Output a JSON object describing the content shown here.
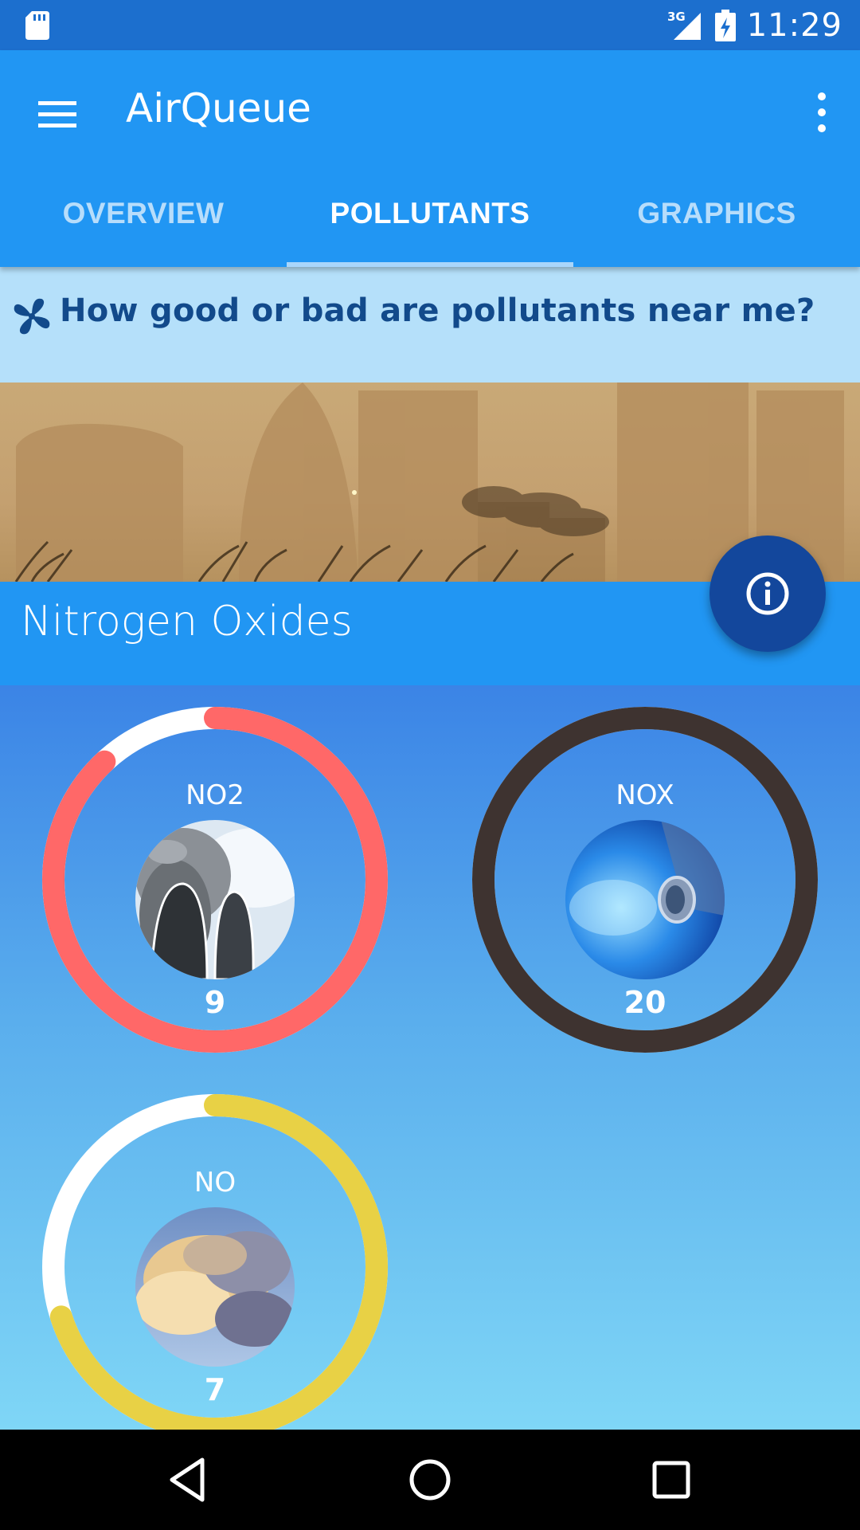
{
  "status_bar": {
    "network": "3G",
    "time": "11:29"
  },
  "app_bar": {
    "title": "AirQueue"
  },
  "tabs": [
    {
      "label": "OVERVIEW",
      "active": false
    },
    {
      "label": "POLLUTANTS",
      "active": true
    },
    {
      "label": "GRAPHICS",
      "active": false
    }
  ],
  "question": {
    "text": "How good or bad are pollutants near me?"
  },
  "section": {
    "title": "Nitrogen Oxides"
  },
  "pollutants": [
    {
      "name": "NO2",
      "value": "9",
      "ring_color": "#ff6868",
      "fill_fraction": 0.88,
      "image": "smoke-stacks"
    },
    {
      "name": "NOX",
      "value": "20",
      "ring_color": "#3e3330",
      "fill_fraction": 1.0,
      "image": "exhaust-pipe"
    },
    {
      "name": "NO",
      "value": "7",
      "ring_color": "#e8d145",
      "fill_fraction": 0.7,
      "image": "clouds"
    }
  ],
  "colors": {
    "primary": "#2196f3",
    "status_bar": "#1c6fce",
    "fab": "#13479c",
    "question_bg": "#b5e0fa",
    "question_text": "#124a8b"
  },
  "icons": {
    "menu": "menu-icon",
    "overflow": "more-vert-icon",
    "info": "info-icon",
    "fan": "fan-icon",
    "back": "back-icon",
    "home": "home-icon",
    "recents": "recents-icon"
  }
}
